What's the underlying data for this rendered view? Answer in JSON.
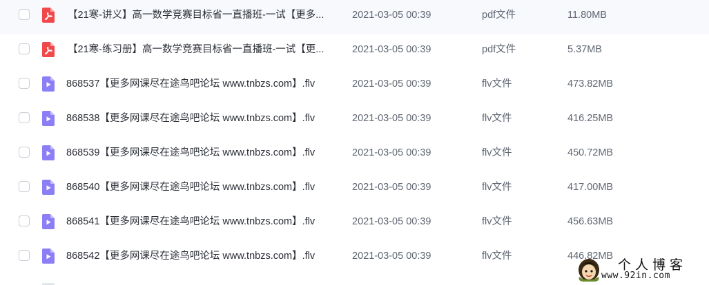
{
  "files": [
    {
      "name": "【21寒-讲义】高一数学竞赛目标省一直播班-一试【更多...",
      "modified": "2021-03-05 00:39",
      "type": "pdf文件",
      "size": "11.80MB",
      "icon": "pdf-icon"
    },
    {
      "name": "【21寒-练习册】高一数学竞赛目标省一直播班-一试【更...",
      "modified": "2021-03-05 00:39",
      "type": "pdf文件",
      "size": "5.37MB",
      "icon": "pdf-icon"
    },
    {
      "name": "868537【更多网课尽在途鸟吧论坛 www.tnbzs.com】.flv",
      "modified": "2021-03-05 00:39",
      "type": "flv文件",
      "size": "473.82MB",
      "icon": "video-icon"
    },
    {
      "name": "868538【更多网课尽在途鸟吧论坛 www.tnbzs.com】.flv",
      "modified": "2021-03-05 00:39",
      "type": "flv文件",
      "size": "416.25MB",
      "icon": "video-icon"
    },
    {
      "name": "868539【更多网课尽在途鸟吧论坛 www.tnbzs.com】.flv",
      "modified": "2021-03-05 00:39",
      "type": "flv文件",
      "size": "450.72MB",
      "icon": "video-icon"
    },
    {
      "name": "868540【更多网课尽在途鸟吧论坛 www.tnbzs.com】.flv",
      "modified": "2021-03-05 00:39",
      "type": "flv文件",
      "size": "417.00MB",
      "icon": "video-icon"
    },
    {
      "name": "868541【更多网课尽在途鸟吧论坛 www.tnbzs.com】.flv",
      "modified": "2021-03-05 00:39",
      "type": "flv文件",
      "size": "456.63MB",
      "icon": "video-icon"
    },
    {
      "name": "868542【更多网课尽在途鸟吧论坛 www.tnbzs.com】.flv",
      "modified": "2021-03-05 00:39",
      "type": "flv文件",
      "size": "446.82MB",
      "icon": "video-icon"
    }
  ],
  "watermark": {
    "title": "个人博客",
    "url": "www.92in.com"
  },
  "colors": {
    "pdf_icon": "#f0494b",
    "video_icon": "#8c7ff5",
    "text_primary": "#2b2f36",
    "text_secondary": "#5f6672",
    "checkbox_border": "#c9ced6"
  }
}
